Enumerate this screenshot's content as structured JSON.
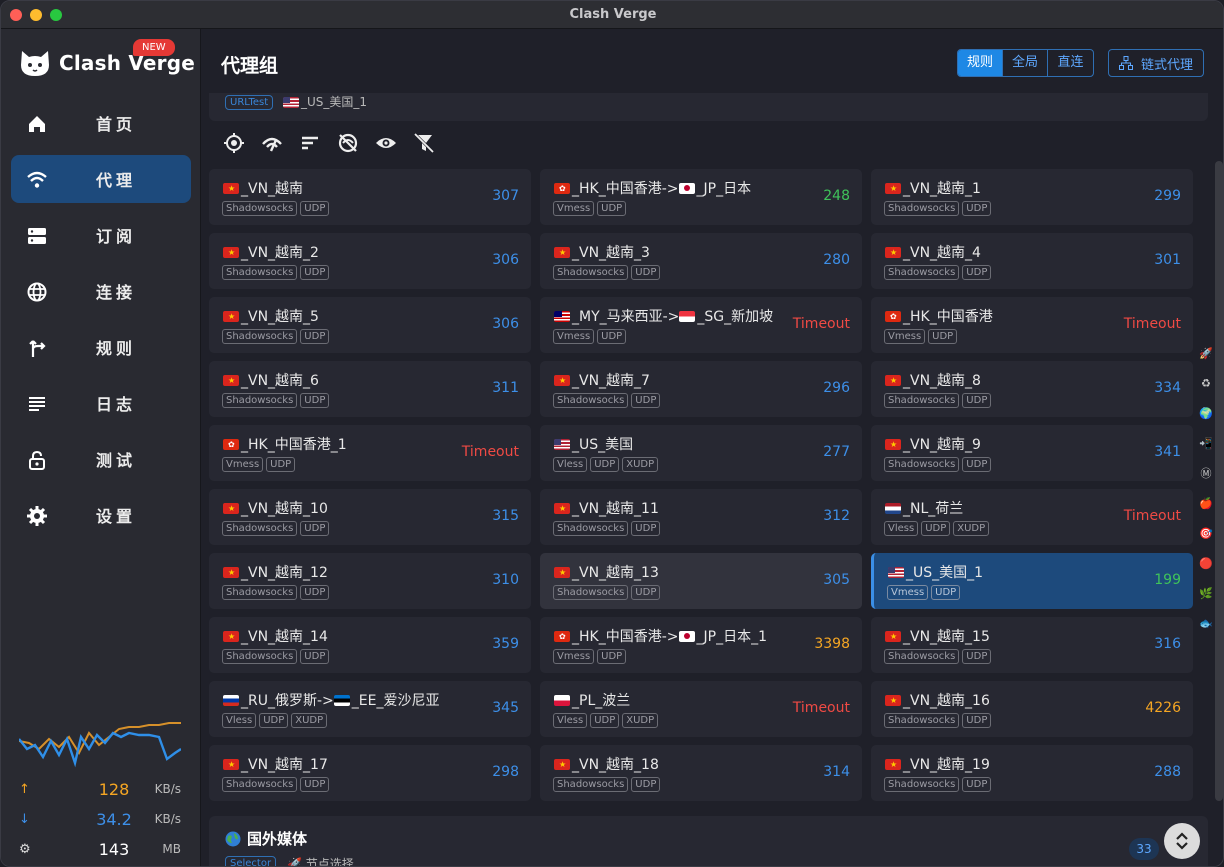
{
  "window": {
    "title": "Clash Verge"
  },
  "brand": {
    "name": "Clash Verge",
    "badge": "NEW"
  },
  "nav": [
    {
      "id": "home",
      "label": "首页",
      "icon": "home-icon"
    },
    {
      "id": "proxy",
      "label": "代理",
      "icon": "wifi-icon",
      "active": true
    },
    {
      "id": "profiles",
      "label": "订阅",
      "icon": "server-icon"
    },
    {
      "id": "connections",
      "label": "连接",
      "icon": "globe-icon"
    },
    {
      "id": "rules",
      "label": "规则",
      "icon": "fork-icon"
    },
    {
      "id": "logs",
      "label": "日志",
      "icon": "list-icon"
    },
    {
      "id": "test",
      "label": "测试",
      "icon": "lock-icon"
    },
    {
      "id": "settings",
      "label": "设置",
      "icon": "gear-icon"
    }
  ],
  "traffic": {
    "up": {
      "value": "128",
      "unit": "KB/s"
    },
    "down": {
      "value": "34.2",
      "unit": "KB/s"
    },
    "mem": {
      "value": "143",
      "unit": "MB"
    }
  },
  "header": {
    "title": "代理组",
    "modes": [
      "规则",
      "全局",
      "直连"
    ],
    "active_mode": "规则",
    "chain_label": "链式代理"
  },
  "current_group": {
    "type": "URLTest",
    "selected": "_US_美国_1"
  },
  "colors": {
    "accent": "#1e88e5",
    "blue": "#3d8fe8",
    "green": "#3fc35a",
    "orange": "#f5a623",
    "red": "#ef4a44"
  },
  "proxies": [
    {
      "flag": "VN",
      "name": "_VN_越南",
      "tags": [
        "Shadowsocks",
        "UDP"
      ],
      "delay": "307",
      "color": "blue"
    },
    {
      "flag": "HK",
      "name": "_HK_中国香港->",
      "flag2": "JP",
      "name2": "_JP_日本",
      "tags": [
        "Vmess",
        "UDP"
      ],
      "delay": "248",
      "color": "green"
    },
    {
      "flag": "VN",
      "name": "_VN_越南_1",
      "tags": [
        "Shadowsocks",
        "UDP"
      ],
      "delay": "299",
      "color": "blue"
    },
    {
      "flag": "VN",
      "name": "_VN_越南_2",
      "tags": [
        "Shadowsocks",
        "UDP"
      ],
      "delay": "306",
      "color": "blue"
    },
    {
      "flag": "VN",
      "name": "_VN_越南_3",
      "tags": [
        "Shadowsocks",
        "UDP"
      ],
      "delay": "280",
      "color": "blue"
    },
    {
      "flag": "VN",
      "name": "_VN_越南_4",
      "tags": [
        "Shadowsocks",
        "UDP"
      ],
      "delay": "301",
      "color": "blue"
    },
    {
      "flag": "VN",
      "name": "_VN_越南_5",
      "tags": [
        "Shadowsocks",
        "UDP"
      ],
      "delay": "306",
      "color": "blue"
    },
    {
      "flag": "MY",
      "name": "_MY_马来西亚->",
      "flag2": "SG",
      "name2": "_SG_新加坡",
      "tags": [
        "Vmess",
        "UDP"
      ],
      "delay": "Timeout",
      "color": "red"
    },
    {
      "flag": "HK",
      "name": "_HK_中国香港",
      "tags": [
        "Vmess",
        "UDP"
      ],
      "delay": "Timeout",
      "color": "red"
    },
    {
      "flag": "VN",
      "name": "_VN_越南_6",
      "tags": [
        "Shadowsocks",
        "UDP"
      ],
      "delay": "311",
      "color": "blue"
    },
    {
      "flag": "VN",
      "name": "_VN_越南_7",
      "tags": [
        "Shadowsocks",
        "UDP"
      ],
      "delay": "296",
      "color": "blue"
    },
    {
      "flag": "VN",
      "name": "_VN_越南_8",
      "tags": [
        "Shadowsocks",
        "UDP"
      ],
      "delay": "334",
      "color": "blue"
    },
    {
      "flag": "HK",
      "name": "_HK_中国香港_1",
      "tags": [
        "Vmess",
        "UDP"
      ],
      "delay": "Timeout",
      "color": "red"
    },
    {
      "flag": "US",
      "name": "_US_美国",
      "tags": [
        "Vless",
        "UDP",
        "XUDP"
      ],
      "delay": "277",
      "color": "blue"
    },
    {
      "flag": "VN",
      "name": "_VN_越南_9",
      "tags": [
        "Shadowsocks",
        "UDP"
      ],
      "delay": "341",
      "color": "blue"
    },
    {
      "flag": "VN",
      "name": "_VN_越南_10",
      "tags": [
        "Shadowsocks",
        "UDP"
      ],
      "delay": "315",
      "color": "blue"
    },
    {
      "flag": "VN",
      "name": "_VN_越南_11",
      "tags": [
        "Shadowsocks",
        "UDP"
      ],
      "delay": "312",
      "color": "blue"
    },
    {
      "flag": "NL",
      "name": "_NL_荷兰",
      "tags": [
        "Vless",
        "UDP",
        "XUDP"
      ],
      "delay": "Timeout",
      "color": "red"
    },
    {
      "flag": "VN",
      "name": "_VN_越南_12",
      "tags": [
        "Shadowsocks",
        "UDP"
      ],
      "delay": "310",
      "color": "blue"
    },
    {
      "flag": "VN",
      "name": "_VN_越南_13",
      "tags": [
        "Shadowsocks",
        "UDP"
      ],
      "delay": "305",
      "color": "blue",
      "hover": true
    },
    {
      "flag": "US",
      "name": "_US_美国_1",
      "tags": [
        "Vmess",
        "UDP"
      ],
      "delay": "199",
      "color": "green",
      "selected": true
    },
    {
      "flag": "VN",
      "name": "_VN_越南_14",
      "tags": [
        "Shadowsocks",
        "UDP"
      ],
      "delay": "359",
      "color": "blue"
    },
    {
      "flag": "HK",
      "name": "_HK_中国香港->",
      "flag2": "JP",
      "name2": "_JP_日本_1",
      "tags": [
        "Vmess",
        "UDP"
      ],
      "delay": "3398",
      "color": "orange"
    },
    {
      "flag": "VN",
      "name": "_VN_越南_15",
      "tags": [
        "Shadowsocks",
        "UDP"
      ],
      "delay": "316",
      "color": "blue"
    },
    {
      "flag": "RU",
      "name": "_RU_俄罗斯->",
      "flag2": "EE",
      "name2": "_EE_爱沙尼亚",
      "tags": [
        "Vless",
        "UDP",
        "XUDP"
      ],
      "delay": "345",
      "color": "blue"
    },
    {
      "flag": "PL",
      "name": "_PL_波兰",
      "tags": [
        "Vless",
        "UDP",
        "XUDP"
      ],
      "delay": "Timeout",
      "color": "red"
    },
    {
      "flag": "VN",
      "name": "_VN_越南_16",
      "tags": [
        "Shadowsocks",
        "UDP"
      ],
      "delay": "4226",
      "color": "orange"
    },
    {
      "flag": "VN",
      "name": "_VN_越南_17",
      "tags": [
        "Shadowsocks",
        "UDP"
      ],
      "delay": "298",
      "color": "blue"
    },
    {
      "flag": "VN",
      "name": "_VN_越南_18",
      "tags": [
        "Shadowsocks",
        "UDP"
      ],
      "delay": "314",
      "color": "blue"
    },
    {
      "flag": "VN",
      "name": "_VN_越南_19",
      "tags": [
        "Shadowsocks",
        "UDP"
      ],
      "delay": "288",
      "color": "blue"
    }
  ],
  "next_group": {
    "icon": "earth-globe-icon",
    "title": "国外媒体",
    "type": "Selector",
    "selected": "节点选择",
    "count": "33"
  },
  "right_rail_icons": [
    "rocket-icon",
    "recycle-icon",
    "globe-icon",
    "phone-icon",
    "at-icon",
    "apple-icon",
    "target-icon",
    "red-dot-icon",
    "leaf-icon",
    "fish-icon"
  ]
}
